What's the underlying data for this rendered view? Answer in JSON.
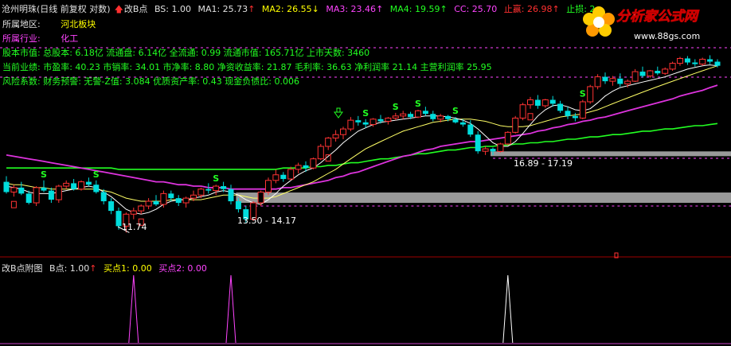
{
  "header": {
    "stock": "沧州明珠(日线 前复权 对数)",
    "indicator": "改B点",
    "bs": "BS: 1.00",
    "ma1": "MA1: 25.73",
    "ma2": "MA2: 26.55",
    "ma3": "MA3: 23.46",
    "ma4": "MA4: 19.59",
    "cc": "CC: 25.70",
    "take_profit": "止赢: 26.98",
    "stop_loss": "止损: 2",
    "colors": {
      "white": "#e0e0e0",
      "yellow": "#ffff00",
      "magenta": "#ff44ff",
      "green": "#22ff22",
      "cyan": "#66ffff",
      "red": "#ff3030"
    }
  },
  "info": {
    "region_label": "所属地区:",
    "region_value": "河北板块",
    "industry_label": "所属行业:",
    "industry_value": "化工",
    "line1": "股本市值: 总股本: 6.18亿 流通盘: 6.14亿 全流通: 0.99 流通市值: 165.71亿 上市天数: 3460",
    "line2": "当前业绩: 市盈率: 40.23 市销率: 34.01 市净率: 8.80 净资收益率: 21.87 毛利率: 36.63 净利润率 21.14 主营利润率 25.95",
    "line3": "风险系数: 财务预警: 无警-Z值: 3.084 优质资产率: 0.43 现金负债比: 0.006"
  },
  "logo": {
    "text": "分析家公式网",
    "url": "www.88gs.com"
  },
  "annotations": {
    "low": "11.74",
    "zone1": "13.50 - 14.17",
    "zone2": "16.89 - 17.19",
    "signal": "S"
  },
  "subchart": {
    "title": "改B点附图",
    "b": "B点: 1.00",
    "buy1": "买点1: 0.00",
    "buy2": "买点2: 0.00"
  },
  "chart_data": {
    "type": "candlestick",
    "title": "沧州明珠(日线 前复权 对数)",
    "candles": [
      [
        14.9,
        15.3,
        14.1,
        14.2
      ],
      [
        14.2,
        14.7,
        13.9,
        14.5
      ],
      [
        14.5,
        14.9,
        14.0,
        14.1
      ],
      [
        14.1,
        14.3,
        13.4,
        13.5
      ],
      [
        13.5,
        14.6,
        13.3,
        14.5
      ],
      [
        14.5,
        15.0,
        14.2,
        14.3
      ],
      [
        14.3,
        14.5,
        13.5,
        13.7
      ],
      [
        13.7,
        14.7,
        13.5,
        14.6
      ],
      [
        14.6,
        15.0,
        14.4,
        14.8
      ],
      [
        14.8,
        15.1,
        14.3,
        14.4
      ],
      [
        14.4,
        15.0,
        14.3,
        14.9
      ],
      [
        14.9,
        15.2,
        14.6,
        14.7
      ],
      [
        14.7,
        15.0,
        14.1,
        14.2
      ],
      [
        14.2,
        14.4,
        13.4,
        13.6
      ],
      [
        13.6,
        13.8,
        12.8,
        13.0
      ],
      [
        13.0,
        13.2,
        11.9,
        12.1
      ],
      [
        12.1,
        12.9,
        11.74,
        12.8
      ],
      [
        12.8,
        13.2,
        12.5,
        13.0
      ],
      [
        13.0,
        13.4,
        12.8,
        13.3
      ],
      [
        13.3,
        13.8,
        13.1,
        13.6
      ],
      [
        13.6,
        14.0,
        13.3,
        13.4
      ],
      [
        13.4,
        14.3,
        13.2,
        14.1
      ],
      [
        14.1,
        14.3,
        13.6,
        13.8
      ],
      [
        13.8,
        14.0,
        13.3,
        13.5
      ],
      [
        13.5,
        13.9,
        13.2,
        13.8
      ],
      [
        13.8,
        14.3,
        13.6,
        14.0
      ],
      [
        14.0,
        14.5,
        13.8,
        14.4
      ],
      [
        14.4,
        14.8,
        14.1,
        14.3
      ],
      [
        14.3,
        14.7,
        14.0,
        14.6
      ],
      [
        14.6,
        14.9,
        14.2,
        14.4
      ],
      [
        14.4,
        14.7,
        13.4,
        13.6
      ],
      [
        13.6,
        13.8,
        12.9,
        13.1
      ],
      [
        13.1,
        13.3,
        12.3,
        12.5
      ],
      [
        12.5,
        13.6,
        12.4,
        13.5
      ],
      [
        13.5,
        14.3,
        13.3,
        14.2
      ],
      [
        14.2,
        15.2,
        14.0,
        15.0
      ],
      [
        15.0,
        15.8,
        14.8,
        15.4
      ],
      [
        15.4,
        15.6,
        14.9,
        15.1
      ],
      [
        15.1,
        16.0,
        15.0,
        15.8
      ],
      [
        15.8,
        16.3,
        15.5,
        16.1
      ],
      [
        16.1,
        16.4,
        15.6,
        15.9
      ],
      [
        15.9,
        16.7,
        15.8,
        16.6
      ],
      [
        16.6,
        17.8,
        16.5,
        17.6
      ],
      [
        17.6,
        18.4,
        17.3,
        18.3
      ],
      [
        18.3,
        19.0,
        18.0,
        18.6
      ],
      [
        18.6,
        19.3,
        18.2,
        19.1
      ],
      [
        19.1,
        20.2,
        18.9,
        19.9
      ],
      [
        19.9,
        20.3,
        19.4,
        19.7
      ],
      [
        19.7,
        20.0,
        19.2,
        19.5
      ],
      [
        19.5,
        20.1,
        19.3,
        20.0
      ],
      [
        20.0,
        20.4,
        19.6,
        19.8
      ],
      [
        19.8,
        20.2,
        19.5,
        20.1
      ],
      [
        20.1,
        20.6,
        19.9,
        20.3
      ],
      [
        20.3,
        20.8,
        20.0,
        20.5
      ],
      [
        20.5,
        20.7,
        20.0,
        20.2
      ],
      [
        20.2,
        20.9,
        20.1,
        20.8
      ],
      [
        20.8,
        21.2,
        20.3,
        20.5
      ],
      [
        20.5,
        20.8,
        19.8,
        20.0
      ],
      [
        20.0,
        20.5,
        19.7,
        20.3
      ],
      [
        20.3,
        20.4,
        19.8,
        20.0
      ],
      [
        20.0,
        20.2,
        19.6,
        19.7
      ],
      [
        19.7,
        20.0,
        19.3,
        19.5
      ],
      [
        19.5,
        19.9,
        18.4,
        18.6
      ],
      [
        18.6,
        18.9,
        17.0,
        17.2
      ],
      [
        17.2,
        17.6,
        16.9,
        17.4
      ],
      [
        17.4,
        17.5,
        16.89,
        17.19
      ],
      [
        17.19,
        17.9,
        17.1,
        17.8
      ],
      [
        17.8,
        18.9,
        17.7,
        18.8
      ],
      [
        18.8,
        20.3,
        18.7,
        20.1
      ],
      [
        20.1,
        21.6,
        19.9,
        21.4
      ],
      [
        21.4,
        22.2,
        21.0,
        21.9
      ],
      [
        21.9,
        22.4,
        21.0,
        21.3
      ],
      [
        21.3,
        22.0,
        21.1,
        21.9
      ],
      [
        21.9,
        22.3,
        21.2,
        21.5
      ],
      [
        21.5,
        21.8,
        20.6,
        20.8
      ],
      [
        20.8,
        21.2,
        20.0,
        20.3
      ],
      [
        20.3,
        20.6,
        19.8,
        20.1
      ],
      [
        20.1,
        21.9,
        20.0,
        21.7
      ],
      [
        21.7,
        23.5,
        21.5,
        23.3
      ],
      [
        23.3,
        24.7,
        23.0,
        24.4
      ],
      [
        24.4,
        24.9,
        23.6,
        23.9
      ],
      [
        23.9,
        24.5,
        23.4,
        24.2
      ],
      [
        24.2,
        24.8,
        23.3,
        23.6
      ],
      [
        23.6,
        24.1,
        23.2,
        23.9
      ],
      [
        23.9,
        25.3,
        23.8,
        25.0
      ],
      [
        25.0,
        25.6,
        24.3,
        24.5
      ],
      [
        24.5,
        25.2,
        24.3,
        25.1
      ],
      [
        25.1,
        25.6,
        24.6,
        24.8
      ],
      [
        24.8,
        25.5,
        24.6,
        25.3
      ],
      [
        25.3,
        26.2,
        25.1,
        26.0
      ],
      [
        26.0,
        26.8,
        25.7,
        26.6
      ],
      [
        26.6,
        26.9,
        25.8,
        26.1
      ],
      [
        26.1,
        26.5,
        25.6,
        25.9
      ],
      [
        25.9,
        26.7,
        25.7,
        26.5
      ],
      [
        26.5,
        27.0,
        25.9,
        26.2
      ],
      [
        26.2,
        26.5,
        25.5,
        25.7
      ]
    ],
    "ma1": [
      14.6,
      14.5,
      14.4,
      14.2,
      14.1,
      14.1,
      14.1,
      14.2,
      14.3,
      14.4,
      14.5,
      14.6,
      14.5,
      14.2,
      13.9,
      13.5,
      13.1,
      12.9,
      12.8,
      12.9,
      13.1,
      13.4,
      13.6,
      13.7,
      13.7,
      13.8,
      13.9,
      14.0,
      14.2,
      14.3,
      14.2,
      14.0,
      13.7,
      13.5,
      13.4,
      13.7,
      14.1,
      14.6,
      15.0,
      15.4,
      15.7,
      15.9,
      16.3,
      16.8,
      17.3,
      17.9,
      18.4,
      18.9,
      19.2,
      19.5,
      19.7,
      19.8,
      19.9,
      20.0,
      20.1,
      20.2,
      20.3,
      20.3,
      20.3,
      20.2,
      20.1,
      19.9,
      19.6,
      19.1,
      18.5,
      17.9,
      17.6,
      17.6,
      18.0,
      18.7,
      19.5,
      20.3,
      20.9,
      21.3,
      21.4,
      21.2,
      20.9,
      20.8,
      21.0,
      21.6,
      22.3,
      22.8,
      23.2,
      23.4,
      23.6,
      23.8,
      24.0,
      24.2,
      24.4,
      24.7,
      25.0,
      25.3,
      25.5,
      25.7,
      25.8,
      25.7
    ],
    "ma2": [
      14.8,
      14.7,
      14.7,
      14.6,
      14.5,
      14.5,
      14.4,
      14.4,
      14.4,
      14.4,
      14.4,
      14.4,
      14.4,
      14.3,
      14.2,
      14.0,
      13.8,
      13.7,
      13.6,
      13.6,
      13.6,
      13.6,
      13.7,
      13.7,
      13.7,
      13.7,
      13.7,
      13.8,
      13.9,
      14.0,
      14.0,
      14.0,
      13.9,
      13.8,
      13.8,
      13.8,
      13.9,
      14.1,
      14.3,
      14.5,
      14.7,
      14.9,
      15.2,
      15.5,
      15.8,
      16.2,
      16.6,
      17.0,
      17.4,
      17.7,
      18.0,
      18.3,
      18.6,
      18.9,
      19.1,
      19.3,
      19.5,
      19.7,
      19.8,
      19.9,
      20.0,
      20.0,
      20.0,
      19.9,
      19.8,
      19.6,
      19.4,
      19.3,
      19.3,
      19.3,
      19.4,
      19.6,
      19.8,
      20.0,
      20.2,
      20.3,
      20.4,
      20.5,
      20.7,
      20.9,
      21.2,
      21.5,
      21.8,
      22.1,
      22.4,
      22.7,
      23.0,
      23.3,
      23.6,
      23.9,
      24.2,
      24.5,
      24.8,
      25.1,
      25.4,
      25.7
    ],
    "ma3": [
      16.9,
      16.8,
      16.7,
      16.6,
      16.5,
      16.4,
      16.3,
      16.2,
      16.1,
      16.0,
      15.9,
      15.8,
      15.7,
      15.6,
      15.5,
      15.4,
      15.3,
      15.2,
      15.1,
      15.0,
      14.9,
      14.9,
      14.8,
      14.7,
      14.7,
      14.6,
      14.6,
      14.5,
      14.5,
      14.5,
      14.4,
      14.4,
      14.4,
      14.4,
      14.4,
      14.4,
      14.4,
      14.5,
      14.5,
      14.6,
      14.7,
      14.8,
      14.9,
      15.0,
      15.2,
      15.3,
      15.5,
      15.6,
      15.8,
      16.0,
      16.2,
      16.4,
      16.6,
      16.8,
      16.9,
      17.1,
      17.3,
      17.4,
      17.6,
      17.7,
      17.8,
      17.9,
      18.0,
      18.0,
      18.1,
      18.2,
      18.3,
      18.4,
      18.5,
      18.6,
      18.7,
      18.9,
      19.0,
      19.2,
      19.3,
      19.5,
      19.6,
      19.8,
      19.9,
      20.1,
      20.2,
      20.4,
      20.6,
      20.8,
      21.0,
      21.2,
      21.4,
      21.6,
      21.8,
      22.0,
      22.3,
      22.5,
      22.7,
      22.9,
      23.2,
      23.46
    ],
    "ma4": [
      15.9,
      15.9,
      15.9,
      15.9,
      15.9,
      15.9,
      15.9,
      15.9,
      15.9,
      15.9,
      15.9,
      15.9,
      15.9,
      15.9,
      15.9,
      15.8,
      15.8,
      15.8,
      15.8,
      15.8,
      15.8,
      15.8,
      15.8,
      15.8,
      15.8,
      15.8,
      15.8,
      15.8,
      15.8,
      15.8,
      15.8,
      15.8,
      15.8,
      15.8,
      15.8,
      15.8,
      15.8,
      15.9,
      15.9,
      15.9,
      15.9,
      16.0,
      16.0,
      16.1,
      16.1,
      16.2,
      16.3,
      16.3,
      16.4,
      16.5,
      16.6,
      16.6,
      16.7,
      16.8,
      16.9,
      17.0,
      17.0,
      17.1,
      17.2,
      17.3,
      17.3,
      17.4,
      17.5,
      17.5,
      17.6,
      17.6,
      17.7,
      17.7,
      17.8,
      17.8,
      17.9,
      17.9,
      18.0,
      18.0,
      18.1,
      18.2,
      18.2,
      18.3,
      18.4,
      18.4,
      18.5,
      18.6,
      18.6,
      18.7,
      18.8,
      18.9,
      18.9,
      19.0,
      19.1,
      19.1,
      19.2,
      19.3,
      19.4,
      19.4,
      19.5,
      19.59
    ],
    "s_signals": [
      5,
      12,
      28,
      48,
      52,
      55,
      60,
      77
    ],
    "b_markers": [
      1,
      18,
      43,
      70
    ],
    "sub_spikes": [
      {
        "index": 17,
        "color": "#ff44ff"
      },
      {
        "index": 30,
        "color": "#ff44ff"
      },
      {
        "index": 67,
        "color": "#ffffff"
      }
    ],
    "zones": [
      {
        "low": 13.5,
        "high": 14.17,
        "start": 31
      },
      {
        "low": 16.89,
        "high": 17.19,
        "start": 65
      }
    ]
  }
}
